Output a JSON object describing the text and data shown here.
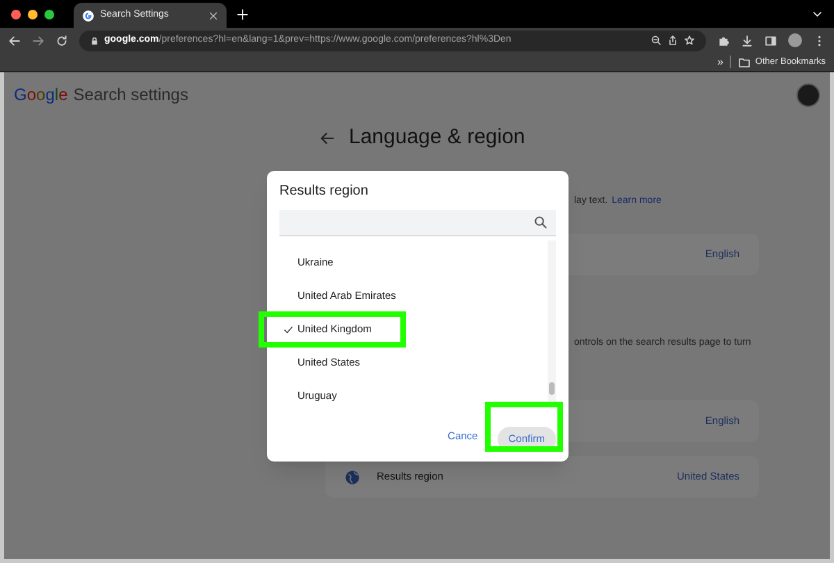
{
  "browser": {
    "tab_title": "Search Settings",
    "url_domain": "google.com",
    "url_rest": "/preferences?hl=en&lang=1&prev=https://www.google.com/preferences?hl%3Den",
    "bookmarks_overflow": "»",
    "bookmark_folder": "Other Bookmarks"
  },
  "page": {
    "brand": "Google",
    "title": "Search settings",
    "heading": "Language & region",
    "partial_texts": [
      {
        "text": "lay text.",
        "link": "Learn more"
      },
      {
        "text": "ontrols on the search results page to turn"
      }
    ],
    "cards": [
      {
        "value": "English",
        "icon": false
      },
      {
        "value": "English",
        "icon": false
      },
      {
        "label": "Results region",
        "value": "United States",
        "icon": true
      }
    ]
  },
  "dialog": {
    "title": "Results region",
    "items": [
      {
        "label": "Ukraine",
        "selected": false,
        "highlighted": false
      },
      {
        "label": "United Arab Emirates",
        "selected": false,
        "highlighted": false
      },
      {
        "label": "United Kingdom",
        "selected": true,
        "highlighted": true
      },
      {
        "label": "United States",
        "selected": false,
        "highlighted": false
      },
      {
        "label": "Uruguay",
        "selected": false,
        "highlighted": false
      }
    ],
    "cancel": "Cance",
    "confirm": {
      "label": "Confirm",
      "highlighted": true
    }
  }
}
